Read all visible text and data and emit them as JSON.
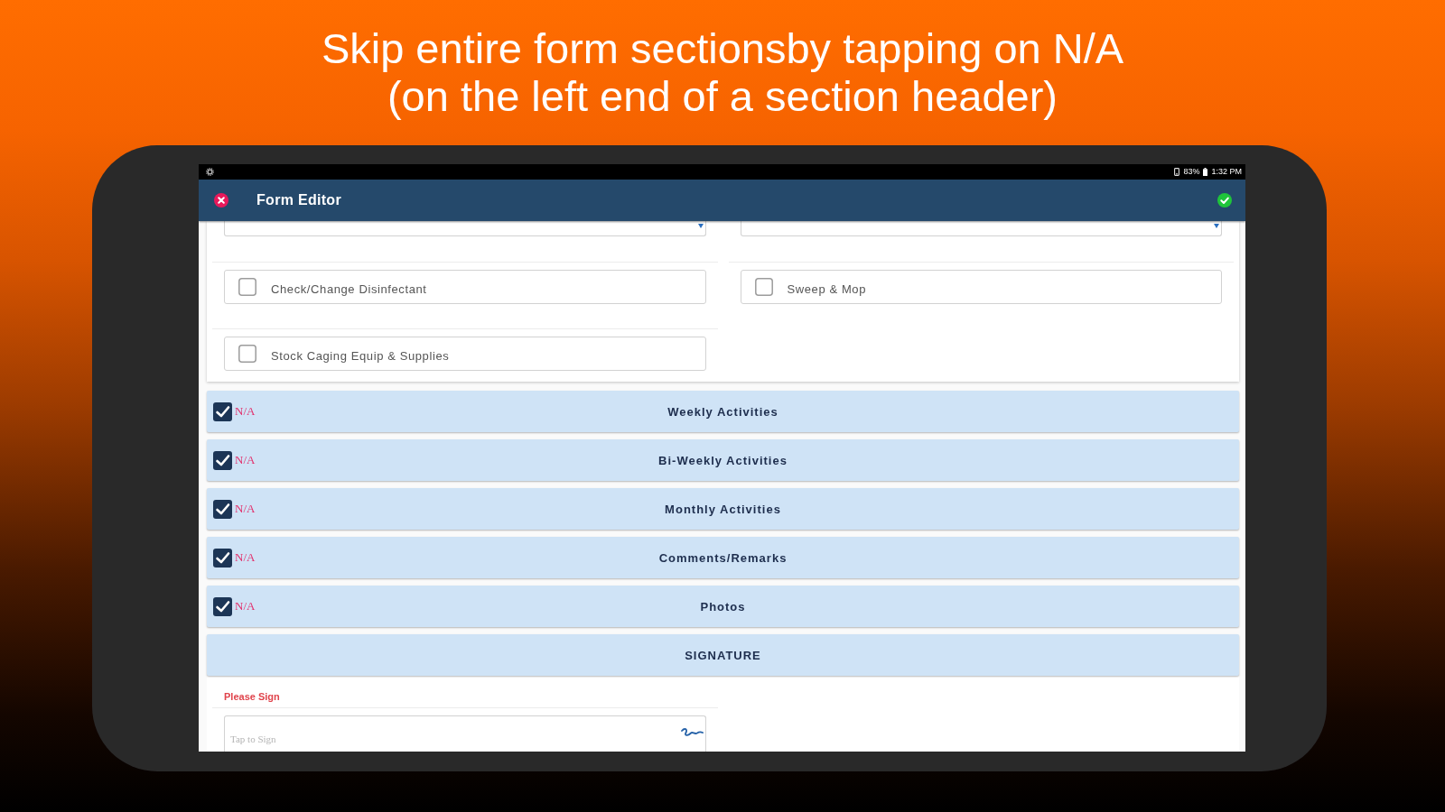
{
  "headline": "Skip entire form sectionsby tapping on N/A\n(on the left end of a section header)",
  "status_bar": {
    "battery": "83%",
    "time": "1:32 PM"
  },
  "app_bar": {
    "title": "Form Editor"
  },
  "top_fields": [
    {
      "kind": "select"
    },
    {
      "kind": "select"
    }
  ],
  "checklist": [
    {
      "label": "Check/Change Disinfectant",
      "checked": false
    },
    {
      "label": "Sweep & Mop",
      "checked": false
    },
    {
      "label": "Stock Caging Equip & Supplies",
      "checked": false
    }
  ],
  "sections": [
    {
      "kind": "skippable",
      "title": "Weekly Activities",
      "na": {
        "label": "N/A",
        "checked": true
      }
    },
    {
      "kind": "skippable",
      "title": "Bi-Weekly Activities",
      "na": {
        "label": "N/A",
        "checked": true
      }
    },
    {
      "kind": "skippable",
      "title": "Monthly Activities",
      "na": {
        "label": "N/A",
        "checked": true
      }
    },
    {
      "kind": "skippable",
      "title": "Comments/Remarks",
      "na": {
        "label": "N/A",
        "checked": true
      }
    },
    {
      "kind": "skippable",
      "title": "Photos",
      "na": {
        "label": "N/A",
        "checked": true
      }
    },
    {
      "kind": "plain",
      "title": "SIGNATURE"
    }
  ],
  "signature": {
    "label": "Please Sign",
    "placeholder": "Tap to Sign"
  }
}
